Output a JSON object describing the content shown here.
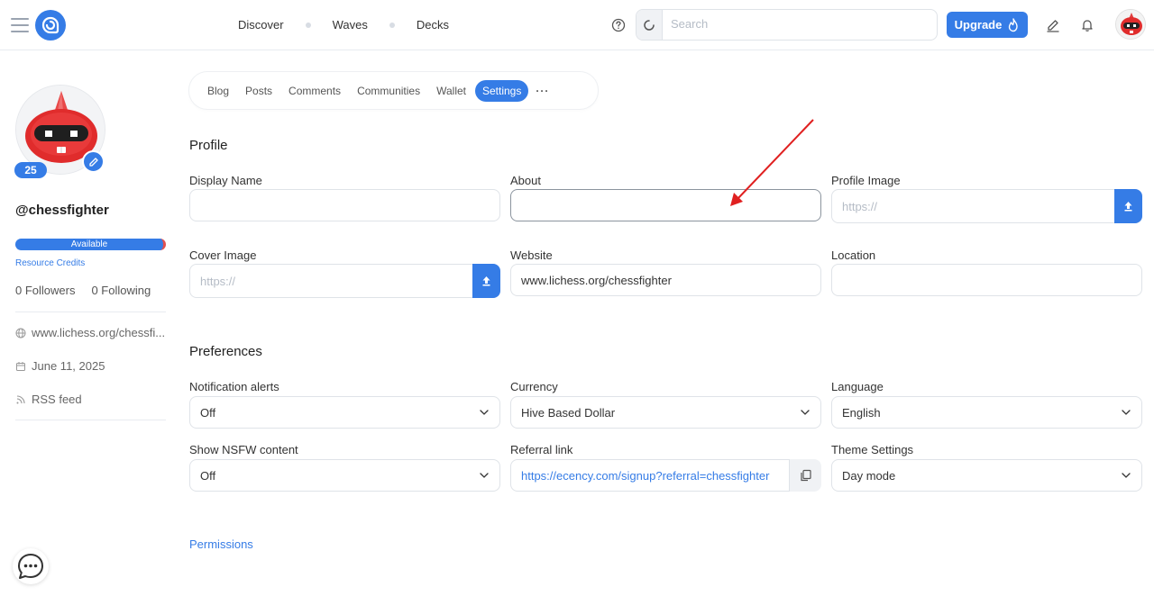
{
  "header": {
    "nav": [
      {
        "label": "Discover"
      },
      {
        "label": "Waves"
      },
      {
        "label": "Decks"
      }
    ],
    "search_placeholder": "Search",
    "upgrade_label": "Upgrade",
    "brand_color": "#357ce6"
  },
  "sidebar": {
    "reputation": "25",
    "username": "@chessfighter",
    "rc_status": "Available",
    "rc_link": "Resource Credits",
    "followers": "0 Followers",
    "following": "0 Following",
    "website": "www.lichess.org/chessfi...",
    "joined": "June 11, 2025",
    "rss": "RSS feed"
  },
  "tabs": {
    "items": [
      "Blog",
      "Posts",
      "Comments",
      "Communities",
      "Wallet",
      "Settings"
    ],
    "active": "Settings",
    "more": "···"
  },
  "profile": {
    "title": "Profile",
    "display_name_label": "Display Name",
    "display_name_value": "",
    "about_label": "About",
    "about_value": "",
    "profile_image_label": "Profile Image",
    "profile_image_placeholder": "https://",
    "cover_image_label": "Cover Image",
    "cover_image_placeholder": "https://",
    "website_label": "Website",
    "website_value": "www.lichess.org/chessfighter",
    "location_label": "Location",
    "location_value": ""
  },
  "preferences": {
    "title": "Preferences",
    "notification_label": "Notification alerts",
    "notification_value": "Off",
    "currency_label": "Currency",
    "currency_value": "Hive Based Dollar",
    "language_label": "Language",
    "language_value": "English",
    "nsfw_label": "Show NSFW content",
    "nsfw_value": "Off",
    "referral_label": "Referral link",
    "referral_value": "https://ecency.com/signup?referral=chessfighter",
    "theme_label": "Theme Settings",
    "theme_value": "Day mode"
  },
  "permissions_label": "Permissions",
  "annotation": {
    "color": "#e02020"
  }
}
